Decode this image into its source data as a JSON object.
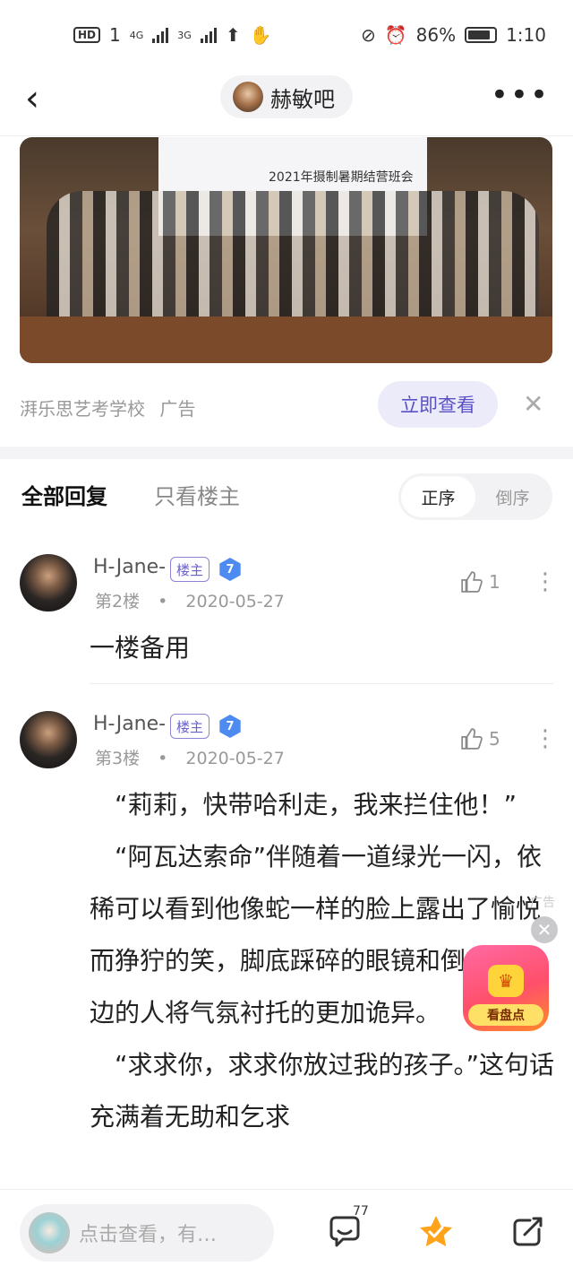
{
  "status_bar": {
    "left_badge": "HD",
    "sim1": "1",
    "net1": "4G",
    "net2": "3G",
    "battery": "86%",
    "time": "1:10"
  },
  "nav": {
    "back_icon": "chevron-left-icon",
    "forum_name": "赫敏吧",
    "more_icon": "more-horizontal-icon"
  },
  "ad": {
    "image_text": "2021年摄制暑期结营班会",
    "source": "湃乐思艺考学校",
    "tag": "广告",
    "cta": "立即查看",
    "close_icon": "close-icon"
  },
  "tabs": {
    "all": "全部回复",
    "op_only": "只看楼主",
    "order_asc": "正序",
    "order_desc": "倒序"
  },
  "posts": [
    {
      "username": "H-Jane-",
      "badge": "楼主",
      "level": "7",
      "floor": "第2楼",
      "date": "2020-05-27",
      "likes": "1",
      "content": [
        "一楼备用"
      ]
    },
    {
      "username": "H-Jane-",
      "badge": "楼主",
      "level": "7",
      "floor": "第3楼",
      "date": "2020-05-27",
      "likes": "5",
      "content": [
        "“莉莉，快带哈利走，我来拦住他！”",
        "“阿瓦达索命”伴随着一道绿光一闪，依稀可以看到他像蛇一样的脸上露出了愉悦而狰狞的笑，脚底踩碎的眼镜和倒在他身边的人将气氛衬托的更加诡异。",
        "“求求你，求求你放过我的孩子。”这句话充满着无助和乞求"
      ]
    }
  ],
  "floating": {
    "label": "看盘点",
    "ad_tag": "广告"
  },
  "bottom_bar": {
    "reply_placeholder": "点击查看，有…",
    "comment_count": "77",
    "icons": [
      "comment-icon",
      "star-icon",
      "share-icon"
    ]
  },
  "colors": {
    "accent": "#5b51c7",
    "star": "#ffa31a",
    "level_badge": "#4e8bf1"
  }
}
